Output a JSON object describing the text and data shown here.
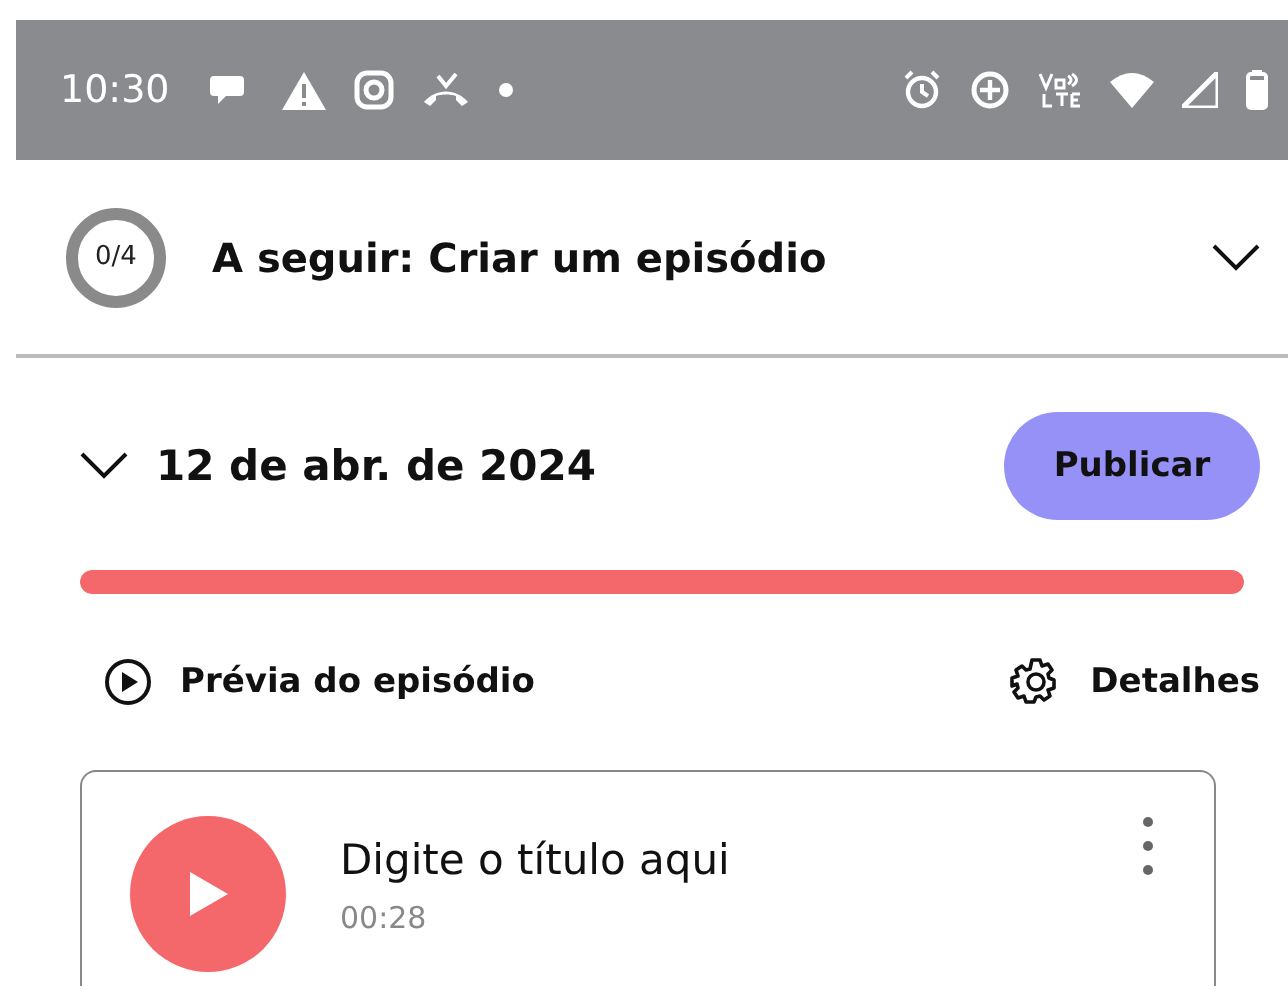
{
  "status_bar": {
    "time": "10:30"
  },
  "task_header": {
    "count": "0/4",
    "title": "A seguir: Criar um episódio",
    "expanded": false
  },
  "episode_group": {
    "date": "12 de abr. de 2024",
    "expanded": true,
    "publish_button": "Publicar",
    "progress": {
      "level": 1.0
    },
    "actions": [
      {
        "kind": "preview",
        "label": "Prévia do episódio"
      },
      {
        "kind": "details",
        "label": "Detalhes"
      }
    ],
    "episode": {
      "title": "Digite o título aqui",
      "duration": "00:28"
    }
  }
}
